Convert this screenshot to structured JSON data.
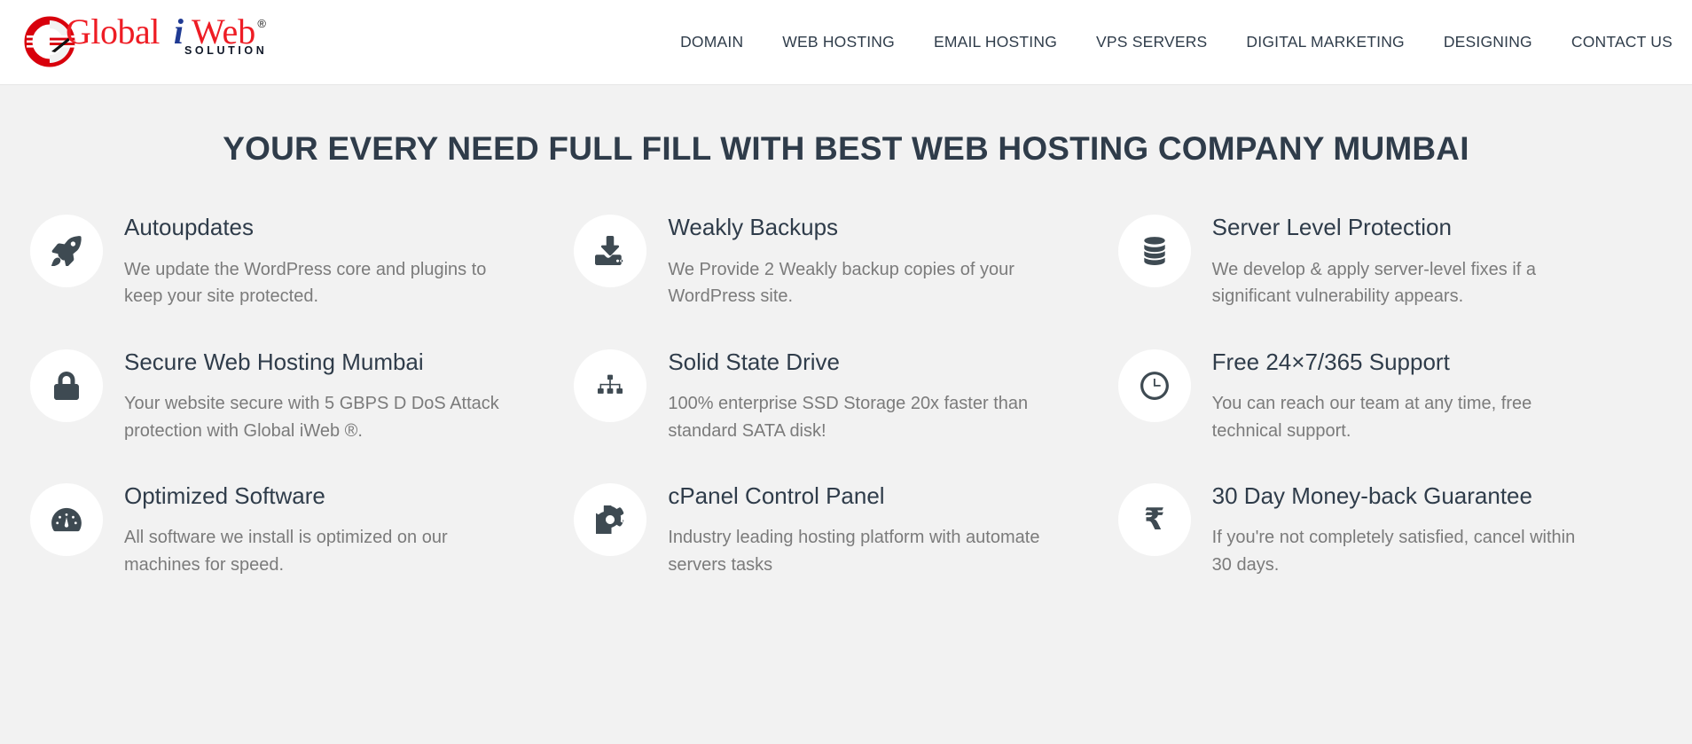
{
  "header": {
    "logo": {
      "word_global": "Global",
      "word_i": "i",
      "word_web": "Web",
      "registered_mark": "®",
      "tagline": "SOLUTION",
      "mark_icon": "globe-c-icon",
      "colors": {
        "red": "#ee1c24",
        "blue": "#1f3a93",
        "dark": "#101828"
      }
    },
    "nav": [
      {
        "label": "DOMAIN",
        "name": "nav-item-domain"
      },
      {
        "label": "WEB HOSTING",
        "name": "nav-item-web-hosting"
      },
      {
        "label": "EMAIL HOSTING",
        "name": "nav-item-email-hosting"
      },
      {
        "label": "VPS SERVERS",
        "name": "nav-item-vps-servers"
      },
      {
        "label": "DIGITAL MARKETING",
        "name": "nav-item-digital-marketing"
      },
      {
        "label": "DESIGNING",
        "name": "nav-item-designing"
      },
      {
        "label": "CONTACT US",
        "name": "nav-item-contact-us"
      }
    ]
  },
  "section": {
    "title": "YOUR EVERY NEED FULL FILL WITH BEST WEB HOSTING COMPANY MUMBAI",
    "background": "#f2f2f2",
    "title_color": "#2f3c4a",
    "icon_circle_color": "#ffffff",
    "icon_glyph_color": "#3e4a52",
    "body_text_color": "#7b7b7b"
  },
  "features": [
    {
      "icon": "rocket-icon",
      "title": "Autoupdates",
      "description": "We update the WordPress core and plugins to keep your site protected."
    },
    {
      "icon": "download-inbox-icon",
      "title": "Weakly Backups",
      "description": "We Provide 2 Weakly backup copies of your WordPress site."
    },
    {
      "icon": "database-stack-icon",
      "title": "Server Level Protection",
      "description": "We develop & apply server-level fixes if a significant vulnerability appears."
    },
    {
      "icon": "lock-icon",
      "title": "Secure Web Hosting Mumbai",
      "description": "Your website secure with 5 GBPS D DoS Attack protection with Global iWeb ®."
    },
    {
      "icon": "sitemap-icon",
      "title": "Solid State Drive",
      "description": "100% enterprise SSD Storage 20x faster than standard SATA disk!"
    },
    {
      "icon": "clock-icon",
      "title": "Free 24×7/365 Support",
      "description": "You can reach our team at any time, free technical support."
    },
    {
      "icon": "tachometer-icon",
      "title": "Optimized Software",
      "description": "All software we install is optimized on our machines for speed."
    },
    {
      "icon": "gear-icon",
      "title": "cPanel Control Panel",
      "description": "Industry leading hosting platform with automate servers tasks"
    },
    {
      "icon": "rupee-icon",
      "title": "30 Day Money-back Guarantee",
      "description": "If you're not completely satisfied, cancel within 30 days."
    }
  ]
}
